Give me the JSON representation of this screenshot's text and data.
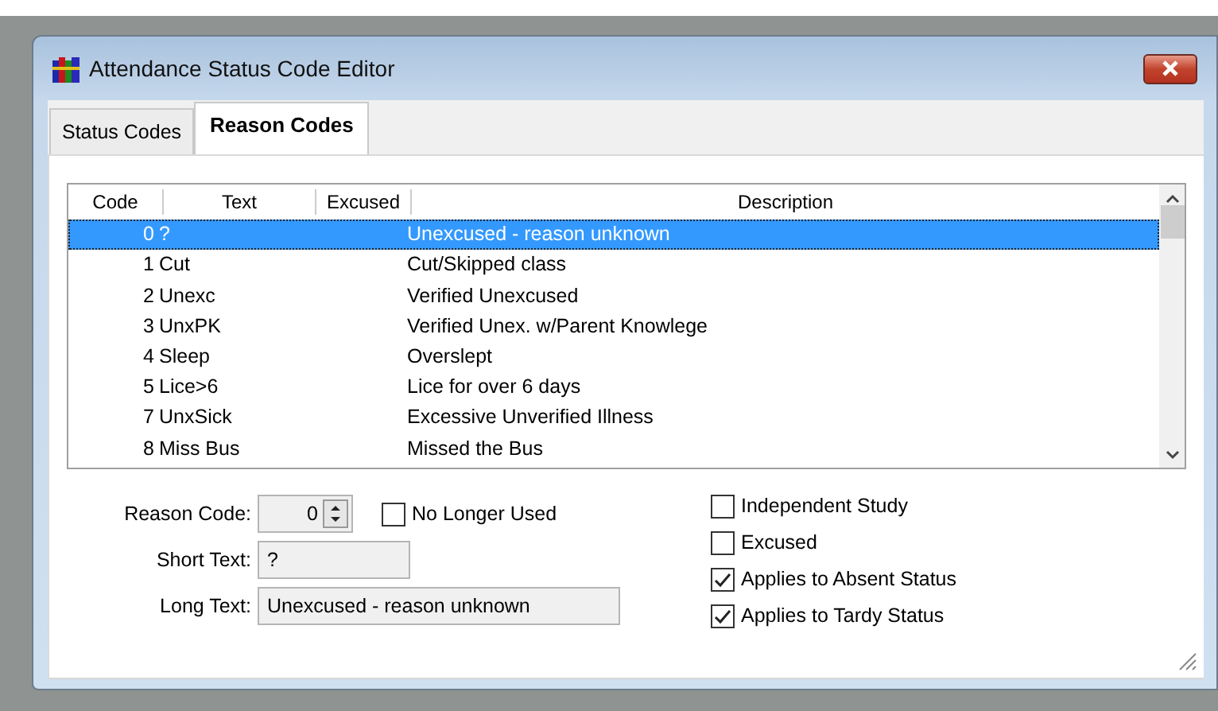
{
  "window": {
    "title": "Attendance Status Code Editor"
  },
  "tabs": [
    {
      "label": "Status Codes",
      "selected": false
    },
    {
      "label": "Reason Codes",
      "selected": true
    }
  ],
  "table": {
    "columns": [
      "Code",
      "Text",
      "Excused",
      "Description"
    ],
    "rows": [
      {
        "code": "0",
        "text": "?",
        "description": "Unexcused - reason unknown",
        "selected": true
      },
      {
        "code": "1",
        "text": "Cut",
        "description": "Cut/Skipped class",
        "selected": false
      },
      {
        "code": "2",
        "text": "Unexc",
        "description": "Verified Unexcused",
        "selected": false
      },
      {
        "code": "3",
        "text": "UnxPK",
        "description": "Verified Unex. w/Parent Knowlege",
        "selected": false
      },
      {
        "code": "4",
        "text": "Sleep",
        "description": "Overslept",
        "selected": false
      },
      {
        "code": "5",
        "text": "Lice>6",
        "description": "Lice for over 6 days",
        "selected": false
      },
      {
        "code": "7",
        "text": "UnxSick",
        "description": "Excessive Unverified Illness",
        "selected": false
      },
      {
        "code": "8",
        "text": "Miss Bus",
        "description": "Missed the Bus",
        "selected": false
      }
    ]
  },
  "form": {
    "reason_code": {
      "label": "Reason Code:",
      "value": "0"
    },
    "no_longer_used": {
      "label": "No Longer Used",
      "checked": false
    },
    "short_text": {
      "label": "Short Text:",
      "value": "?"
    },
    "long_text": {
      "label": "Long Text:",
      "value": "Unexcused - reason unknown"
    }
  },
  "options": [
    {
      "label": "Independent Study",
      "checked": false
    },
    {
      "label": "Excused",
      "checked": false
    },
    {
      "label": "Applies to Absent Status",
      "checked": true
    },
    {
      "label": "Applies to Tardy Status",
      "checked": true
    }
  ]
}
